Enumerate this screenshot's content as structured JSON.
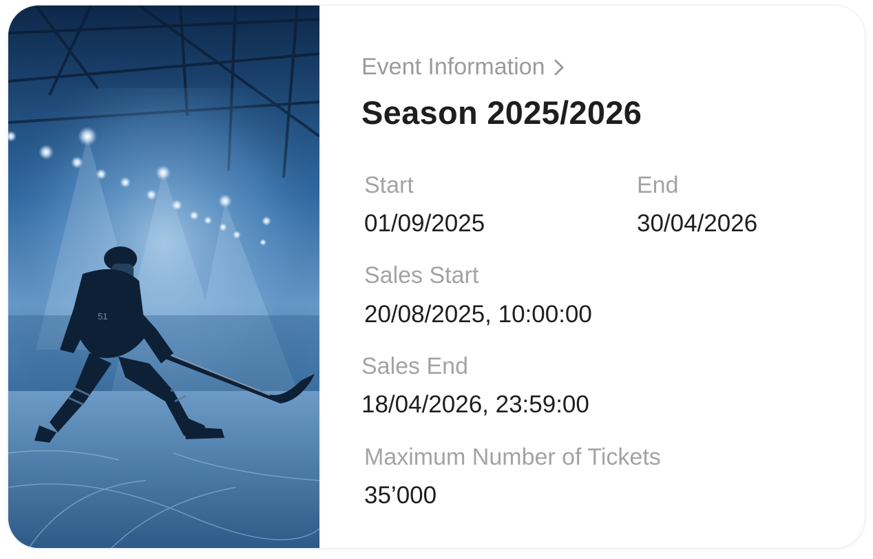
{
  "event": {
    "breadcrumb": "Event Information",
    "title": "Season 2025/2026",
    "start_label": "Start",
    "start_value": "01/09/2025",
    "end_label": "End",
    "end_value": "30/04/2026",
    "sales_start_label": "Sales Start",
    "sales_start_value": "20/08/2025, 10:00:00",
    "sales_end_label": "Sales End",
    "sales_end_value": "18/04/2026, 23:59:00",
    "max_tickets_label": "Maximum Number of Tickets",
    "max_tickets_value": "35’000"
  },
  "image": {
    "icon": "hockey-player-photo",
    "jersey_number": "51"
  },
  "colors": {
    "label": "#a3a3a3",
    "value": "#1e1e1e",
    "photo_tint": "#2f6aa4"
  }
}
